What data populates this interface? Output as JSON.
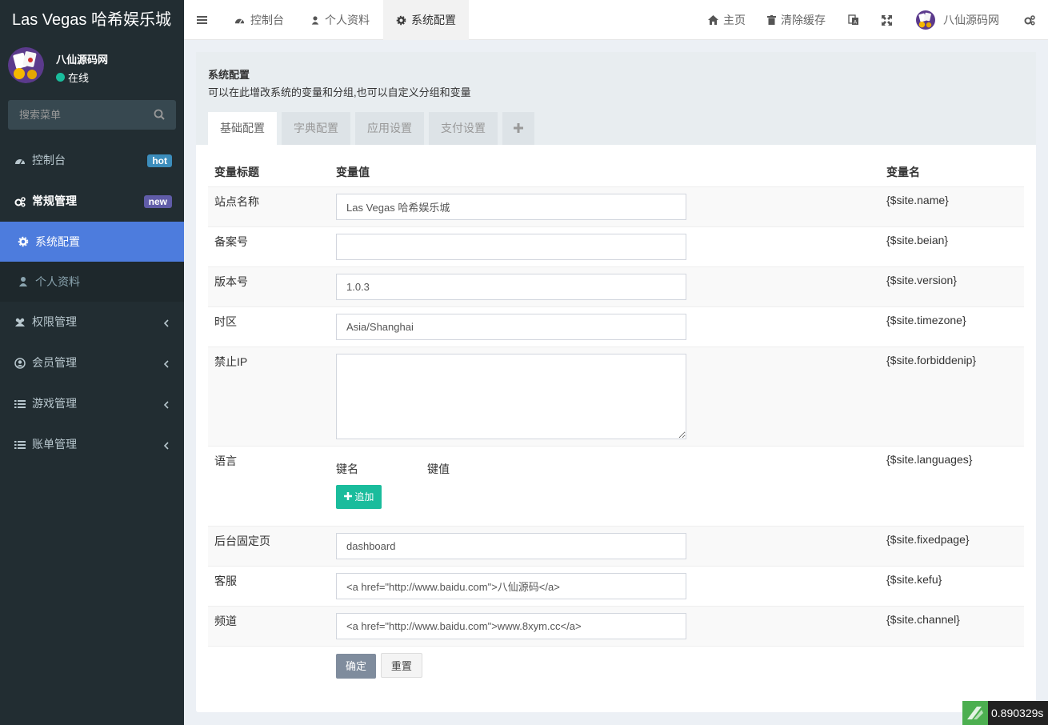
{
  "brand": "Las Vegas 哈希娱乐城",
  "user": {
    "name": "八仙源码网",
    "status": "在线"
  },
  "search": {
    "placeholder": "搜索菜单"
  },
  "menu": {
    "dashboard": {
      "label": "控制台",
      "badge": "hot",
      "badge_color": "#3c8dbc"
    },
    "general": {
      "label": "常规管理",
      "badge": "new",
      "badge_color": "#605ca8"
    },
    "general_sub": [
      {
        "label": "系统配置"
      },
      {
        "label": "个人资料"
      }
    ],
    "auth": {
      "label": "权限管理"
    },
    "member": {
      "label": "会员管理"
    },
    "game": {
      "label": "游戏管理"
    },
    "bill": {
      "label": "账单管理"
    }
  },
  "header": {
    "tabs": [
      {
        "label": "控制台"
      },
      {
        "label": "个人资料"
      },
      {
        "label": "系统配置"
      }
    ],
    "home": "主页",
    "clear_cache": "清除缓存",
    "user": "八仙源码网"
  },
  "page": {
    "title": "系统配置",
    "desc": "可以在此增改系统的变量和分组,也可以自定义分组和变量",
    "tabs": [
      {
        "label": "基础配置"
      },
      {
        "label": "字典配置"
      },
      {
        "label": "应用设置"
      },
      {
        "label": "支付设置"
      }
    ],
    "columns": {
      "title": "变量标题",
      "value": "变量值",
      "name": "变量名"
    },
    "rows": [
      {
        "title": "站点名称",
        "value": "Las Vegas 哈希娱乐城",
        "var": "{$site.name}"
      },
      {
        "title": "备案号",
        "value": "",
        "var": "{$site.beian}"
      },
      {
        "title": "版本号",
        "value": "1.0.3",
        "var": "{$site.version}"
      },
      {
        "title": "时区",
        "value": "Asia/Shanghai",
        "var": "{$site.timezone}"
      },
      {
        "title": "禁止IP",
        "value": "",
        "var": "{$site.forbiddenip}"
      },
      {
        "title": "语言",
        "key_label": "键名",
        "val_label": "键值",
        "add": "追加",
        "var": "{$site.languages}"
      },
      {
        "title": "后台固定页",
        "value": "dashboard",
        "var": "{$site.fixedpage}"
      },
      {
        "title": "客服",
        "value": "<a href=\"http://www.baidu.com\">八仙源码</a>",
        "var": "{$site.kefu}"
      },
      {
        "title": "频道",
        "value": "<a href=\"http://www.baidu.com\">www.8xym.cc</a>",
        "var": "{$site.channel}"
      }
    ],
    "submit": "确定",
    "reset": "重置"
  },
  "timer": "0.890329s"
}
